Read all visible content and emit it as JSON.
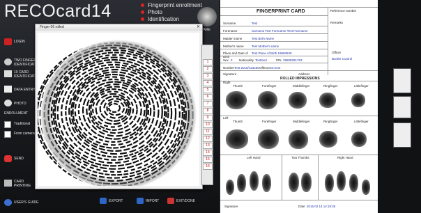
{
  "app": {
    "title": "RECOcard14",
    "top_menu": [
      "Fingerprint enrollment",
      "Photo",
      "Identification"
    ],
    "logo_text": "WARE",
    "side_items": [
      {
        "label": "LOGIN",
        "icon": "login-icon"
      },
      {
        "label": "TWO FINGER IDENTIFICATION",
        "icon": "fingerprint-icon"
      },
      {
        "label": "10 CARD IDENTIFICATION",
        "icon": "card-icon"
      },
      {
        "label": "DATA ENTRY",
        "icon": "edit-icon"
      },
      {
        "label": "PHOTO",
        "icon": "camera-icon"
      },
      {
        "label": "ENROLLMENT",
        "icon": ""
      },
      {
        "label": "Traditional",
        "icon": "checkbox-icon"
      },
      {
        "label": "From camera and",
        "icon": "checkbox-icon"
      },
      {
        "label": "SEND",
        "icon": "send-icon"
      },
      {
        "label": "CARD PRINTING",
        "icon": "print-icon"
      },
      {
        "label": "USER'S GUIDE",
        "icon": "help-icon"
      }
    ],
    "bottom": [
      "EXPORT",
      "IMPORT",
      "EXIT/DONE"
    ]
  },
  "fp_window": {
    "title": "Finger 06 rolled",
    "numbers": [
      "1",
      "2",
      "3",
      "4",
      "5",
      "6",
      "7",
      "8",
      "9",
      "10",
      "11",
      "12",
      "13",
      "14",
      "15",
      "16"
    ]
  },
  "card": {
    "title": "FINGERPRINT CARD",
    "reference_label": "Reference number",
    "remarks_label": "Remarks",
    "officer_label": "Officer",
    "officer_value": "Border Control",
    "fields": [
      {
        "label": "Surname",
        "value": "Test"
      },
      {
        "label": "Forename",
        "value": "Surname Test Forename Test Forename"
      },
      {
        "label": "Maiden name",
        "value": "Test Birth Name"
      },
      {
        "label": "Mother's name",
        "value": "Test Mother's name"
      },
      {
        "label": "Place and Date of Birth",
        "value": "Test Place of Birth      19960829"
      }
    ],
    "sex_label": "Sex",
    "sex_value": "2",
    "nationality_label": "Nationality",
    "nationality_value": "Testland",
    "pin_label": "PIN",
    "pin_value": "29608291763",
    "number_label": "Number",
    "number_value": "Test 2016/123456",
    "offence_label": "Offence",
    "offence_value": "Do test",
    "signature_label": "Signature",
    "address_label": "Address",
    "rolled_title": "ROLLED IMPRESSIONS",
    "right_label": "Right",
    "left_label": "Left",
    "finger_names": [
      "Thumb",
      "Forefinger",
      "Middlefinger",
      "Ringfinger",
      "Littlefinger"
    ],
    "plain_labels": [
      "Left Hand",
      "Two Thumbs",
      "Right Hand"
    ],
    "footer_signature": "Signature",
    "date_label": "Date",
    "date_value": "2016.02.14    14:19:35"
  }
}
